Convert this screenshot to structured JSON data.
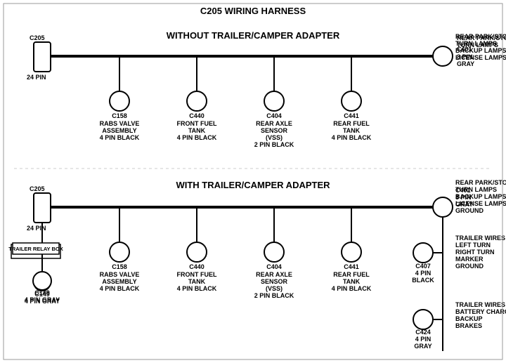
{
  "title": "C205 WIRING HARNESS",
  "top_section": {
    "label": "WITHOUT TRAILER/CAMPER ADAPTER",
    "left_connector": {
      "name": "C205",
      "sub": "24 PIN"
    },
    "right_connector": {
      "name": "C401",
      "sub": "8 PIN",
      "color": "GRAY",
      "desc": [
        "REAR PARK/STOP",
        "TURN LAMPS",
        "BACKUP LAMPS",
        "LICENSE LAMPS"
      ]
    },
    "connectors": [
      {
        "name": "C158",
        "desc": [
          "RABS VALVE",
          "ASSEMBLY",
          "4 PIN BLACK"
        ]
      },
      {
        "name": "C440",
        "desc": [
          "FRONT FUEL",
          "TANK",
          "4 PIN BLACK"
        ]
      },
      {
        "name": "C404",
        "desc": [
          "REAR AXLE",
          "SENSOR",
          "(VSS)",
          "2 PIN BLACK"
        ]
      },
      {
        "name": "C441",
        "desc": [
          "REAR FUEL",
          "TANK",
          "4 PIN BLACK"
        ]
      }
    ]
  },
  "bottom_section": {
    "label": "WITH TRAILER/CAMPER ADAPTER",
    "left_connector": {
      "name": "C205",
      "sub": "24 PIN"
    },
    "right_connector": {
      "name": "C401",
      "sub": "8 PIN",
      "color": "GRAY",
      "desc": [
        "REAR PARK/STOP",
        "TURN LAMPS",
        "BACKUP LAMPS",
        "LICENSE LAMPS",
        "GROUND"
      ]
    },
    "extra_left": {
      "box": "TRAILER RELAY BOX",
      "name": "C149",
      "sub": "4 PIN GRAY"
    },
    "connectors": [
      {
        "name": "C158",
        "desc": [
          "RABS VALVE",
          "ASSEMBLY",
          "4 PIN BLACK"
        ]
      },
      {
        "name": "C440",
        "desc": [
          "FRONT FUEL",
          "TANK",
          "4 PIN BLACK"
        ]
      },
      {
        "name": "C404",
        "desc": [
          "REAR AXLE",
          "SENSOR",
          "(VSS)",
          "2 PIN BLACK"
        ]
      },
      {
        "name": "C441",
        "desc": [
          "REAR FUEL",
          "TANK",
          "4 PIN BLACK"
        ]
      }
    ],
    "right_extra": [
      {
        "name": "C407",
        "sub": "4 PIN",
        "color": "BLACK",
        "desc": [
          "TRAILER WIRES",
          "LEFT TURN",
          "RIGHT TURN",
          "MARKER",
          "GROUND"
        ]
      },
      {
        "name": "C424",
        "sub": "4 PIN",
        "color": "GRAY",
        "desc": [
          "TRAILER WIRES",
          "BATTERY CHARGE",
          "BACKUP",
          "BRAKES"
        ]
      }
    ]
  }
}
